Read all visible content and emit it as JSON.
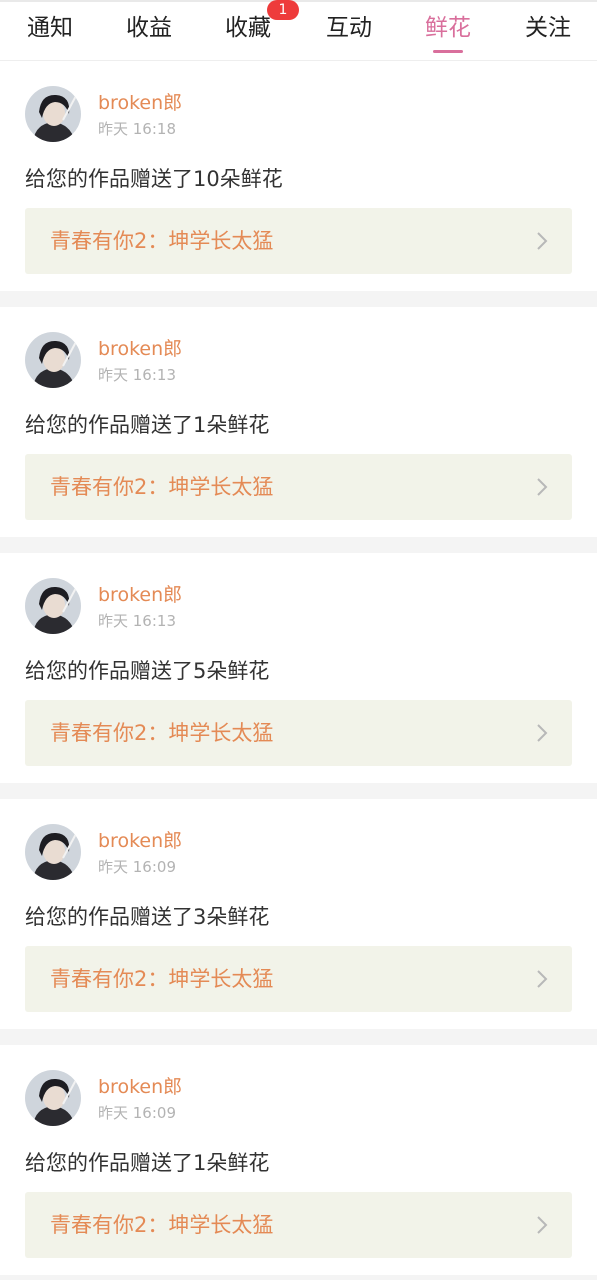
{
  "tabs": [
    {
      "label": "通知"
    },
    {
      "label": "收益"
    },
    {
      "label": "收藏",
      "badge": "1"
    },
    {
      "label": "互动"
    },
    {
      "label": "鲜花",
      "active": true
    },
    {
      "label": "关注"
    }
  ],
  "colors": {
    "accent_pink": "#d96f9c",
    "username_orange": "#e48a55",
    "badge_red": "#ee3b3b",
    "link_bg": "#f2f3e9"
  },
  "icons": {
    "avatar": "user-avatar-photo",
    "chevron": "chevron-right-icon"
  },
  "items": [
    {
      "user": "broken郎",
      "time": "昨天 16:18",
      "message": "给您的作品赠送了10朵鲜花",
      "work": "青春有你2：坤学长太猛"
    },
    {
      "user": "broken郎",
      "time": "昨天 16:13",
      "message": "给您的作品赠送了1朵鲜花",
      "work": "青春有你2：坤学长太猛"
    },
    {
      "user": "broken郎",
      "time": "昨天 16:13",
      "message": "给您的作品赠送了5朵鲜花",
      "work": "青春有你2：坤学长太猛"
    },
    {
      "user": "broken郎",
      "time": "昨天 16:09",
      "message": "给您的作品赠送了3朵鲜花",
      "work": "青春有你2：坤学长太猛"
    },
    {
      "user": "broken郎",
      "time": "昨天 16:09",
      "message": "给您的作品赠送了1朵鲜花",
      "work": "青春有你2：坤学长太猛"
    }
  ]
}
